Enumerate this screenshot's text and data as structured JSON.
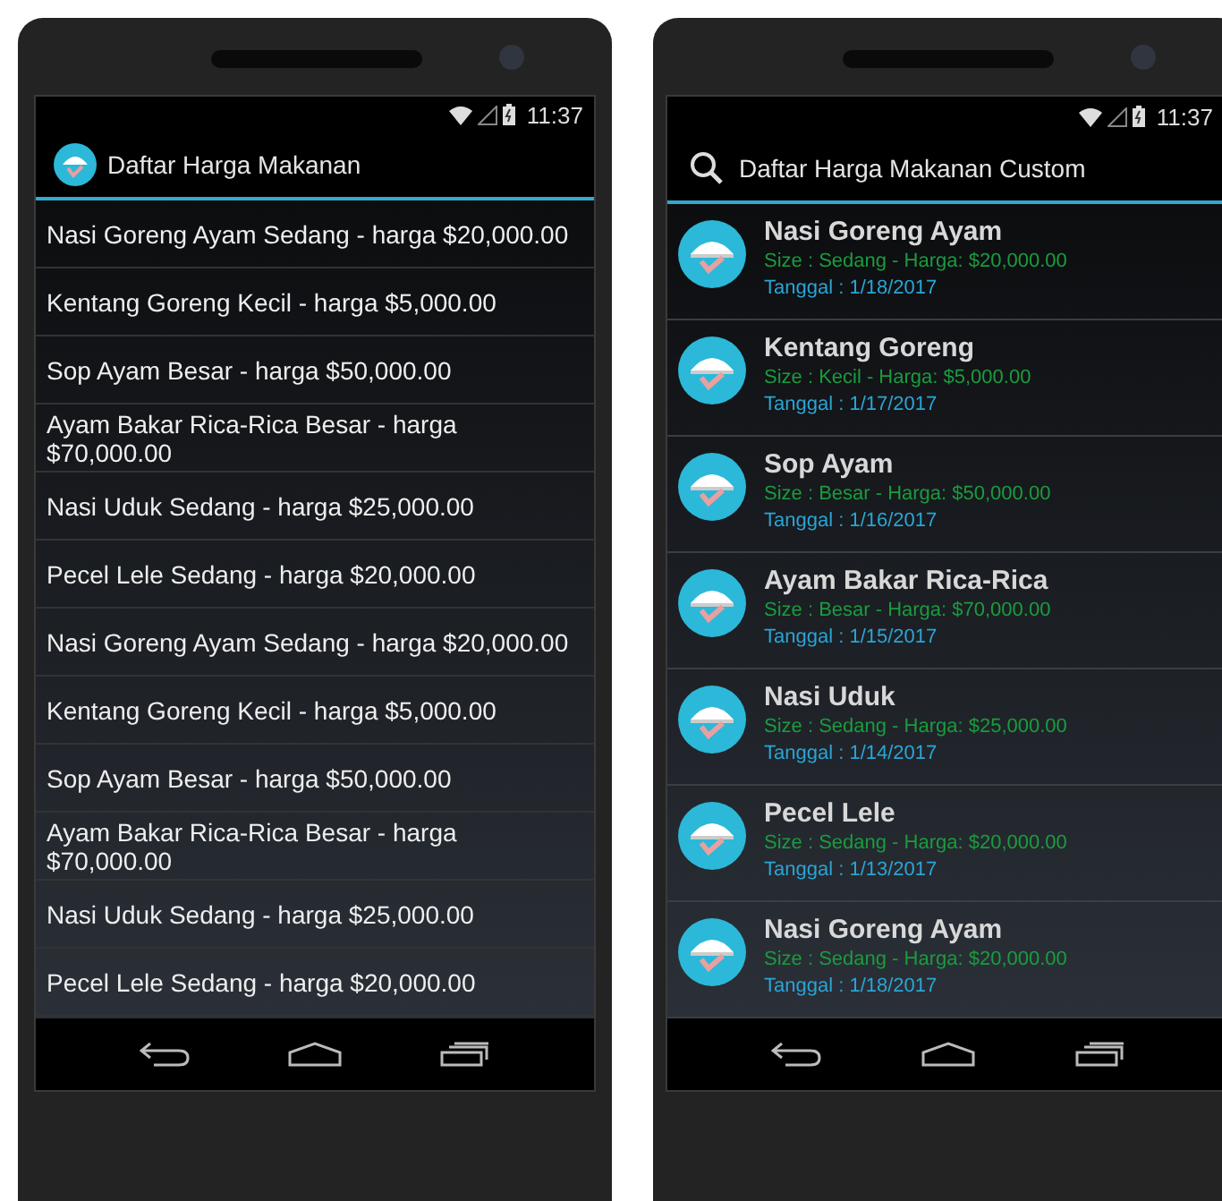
{
  "phones": [
    {
      "kind": "simple",
      "status_time": "11:37",
      "title": "Daftar Harga Makanan",
      "items": [
        {
          "text": "Nasi Goreng Ayam Sedang - harga $20,000.00"
        },
        {
          "text": "Kentang Goreng Kecil - harga $5,000.00"
        },
        {
          "text": "Sop Ayam Besar - harga $50,000.00"
        },
        {
          "text": "Ayam Bakar Rica-Rica Besar - harga $70,000.00"
        },
        {
          "text": "Nasi Uduk Sedang - harga $25,000.00"
        },
        {
          "text": "Pecel Lele Sedang - harga $20,000.00"
        },
        {
          "text": "Nasi Goreng Ayam Sedang - harga $20,000.00"
        },
        {
          "text": "Kentang Goreng Kecil - harga $5,000.00"
        },
        {
          "text": "Sop Ayam Besar - harga $50,000.00"
        },
        {
          "text": "Ayam Bakar Rica-Rica Besar - harga $70,000.00"
        },
        {
          "text": "Nasi Uduk Sedang - harga $25,000.00"
        },
        {
          "text": "Pecel Lele Sedang - harga $20,000.00"
        }
      ]
    },
    {
      "kind": "custom",
      "status_time": "11:37",
      "title": "Daftar Harga Makanan Custom",
      "items": [
        {
          "name": "Nasi Goreng Ayam",
          "detail": "Size : Sedang - Harga: $20,000.00",
          "date": "Tanggal : 1/18/2017"
        },
        {
          "name": "Kentang Goreng",
          "detail": "Size : Kecil - Harga: $5,000.00",
          "date": "Tanggal : 1/17/2017"
        },
        {
          "name": "Sop Ayam",
          "detail": "Size : Besar - Harga: $50,000.00",
          "date": "Tanggal : 1/16/2017"
        },
        {
          "name": "Ayam Bakar Rica-Rica",
          "detail": "Size : Besar - Harga: $70,000.00",
          "date": "Tanggal : 1/15/2017"
        },
        {
          "name": "Nasi Uduk",
          "detail": "Size : Sedang - Harga: $25,000.00",
          "date": "Tanggal : 1/14/2017"
        },
        {
          "name": "Pecel Lele",
          "detail": "Size : Sedang - Harga: $20,000.00",
          "date": "Tanggal : 1/13/2017"
        },
        {
          "name": "Nasi Goreng Ayam",
          "detail": "Size : Sedang - Harga: $20,000.00",
          "date": "Tanggal : 1/18/2017"
        }
      ]
    }
  ]
}
